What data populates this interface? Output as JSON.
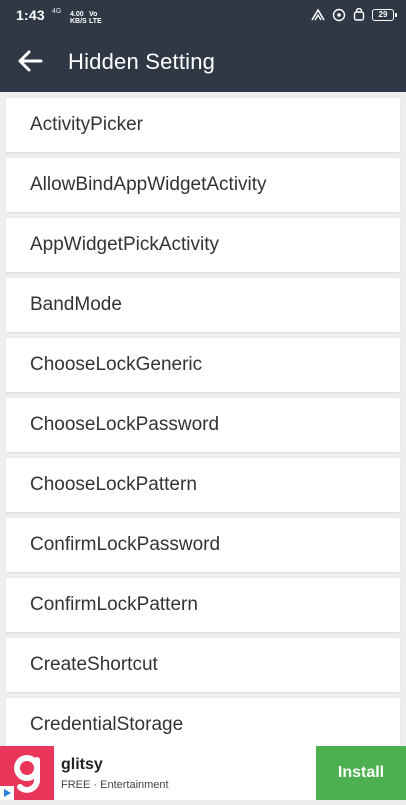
{
  "status_bar": {
    "time": "1:43",
    "network_small": "4G",
    "speed_value": "4.00",
    "speed_unit": "KB/S",
    "volte": "Vo",
    "lte": "LTE",
    "battery": "29",
    "icons": [
      "signal-icon",
      "hotspot-icon",
      "alarm-icon",
      "battery-icon"
    ]
  },
  "app_bar": {
    "title": "Hidden Setting",
    "back_icon": "arrow-left-icon",
    "background": "#303846"
  },
  "list": {
    "items": [
      "ActivityPicker",
      "AllowBindAppWidgetActivity",
      "AppWidgetPickActivity",
      "BandMode",
      "ChooseLockGeneric",
      "ChooseLockPassword",
      "ChooseLockPattern",
      "ConfirmLockPassword",
      "ConfirmLockPattern",
      "CreateShortcut",
      "CredentialStorage"
    ]
  },
  "ad": {
    "app_name": "glitsy",
    "subtitle": "FREE · Entertainment",
    "install_label": "Install",
    "logo_color": "#e8355a",
    "install_color": "#4caf50"
  }
}
